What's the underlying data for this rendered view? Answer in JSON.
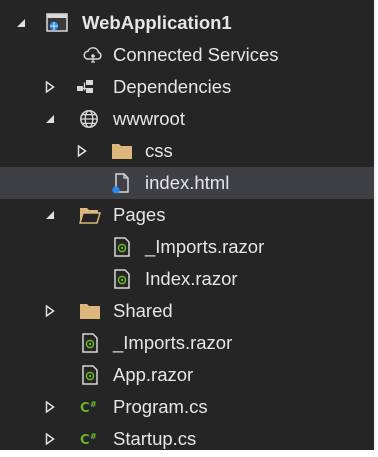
{
  "solution_explorer": {
    "items": [
      {
        "label": "WebApplication1",
        "icon": "web-project-icon",
        "expander": "expanded"
      },
      {
        "label": "Connected Services",
        "icon": "connected-services-icon",
        "expander": "none"
      },
      {
        "label": "Dependencies",
        "icon": "dependencies-icon",
        "expander": "collapsed"
      },
      {
        "label": "wwwroot",
        "icon": "globe-icon",
        "expander": "expanded"
      },
      {
        "label": "css",
        "icon": "folder-icon",
        "expander": "collapsed"
      },
      {
        "label": "index.html",
        "icon": "html-file-icon",
        "expander": "none",
        "selected": true
      },
      {
        "label": "Pages",
        "icon": "folder-open-icon",
        "expander": "expanded"
      },
      {
        "label": "_Imports.razor",
        "icon": "razor-file-icon",
        "expander": "none"
      },
      {
        "label": "Index.razor",
        "icon": "razor-file-icon",
        "expander": "none"
      },
      {
        "label": "Shared",
        "icon": "folder-icon",
        "expander": "collapsed"
      },
      {
        "label": "_Imports.razor",
        "icon": "razor-file-icon",
        "expander": "none"
      },
      {
        "label": "App.razor",
        "icon": "razor-file-icon",
        "expander": "none"
      },
      {
        "label": "Program.cs",
        "icon": "csharp-file-icon",
        "expander": "collapsed"
      },
      {
        "label": "Startup.cs",
        "icon": "csharp-file-icon",
        "expander": "collapsed"
      }
    ]
  },
  "colors": {
    "background": "#252526",
    "selection": "#3f3f46",
    "text": "#e6e6e6",
    "folder": "#dcb67a",
    "csharp": "#68b723",
    "project": "#1e90ff"
  }
}
